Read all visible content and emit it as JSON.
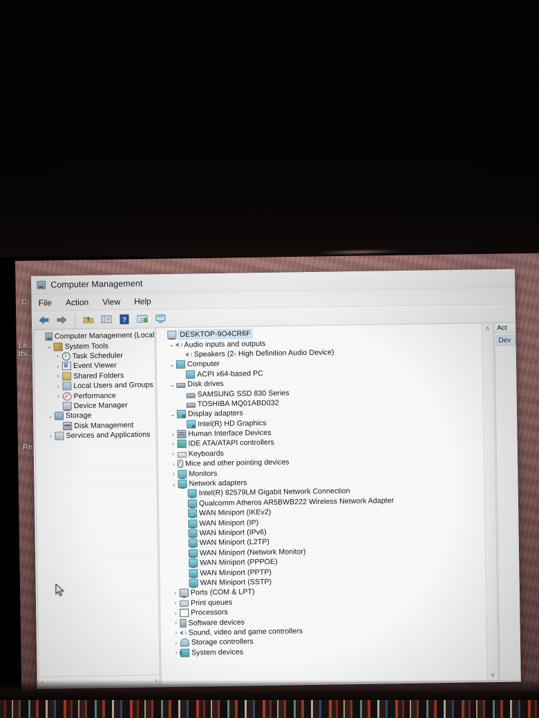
{
  "window": {
    "title": "Computer Management",
    "icon": "computer-management-icon",
    "menu": [
      "File",
      "Action",
      "View",
      "Help"
    ],
    "toolbar": [
      {
        "name": "back-button",
        "glyph": "back-arrow-icon"
      },
      {
        "name": "forward-button",
        "glyph": "forward-arrow-icon"
      },
      {
        "name": "up-one-level-button",
        "glyph": "up-folder-icon"
      },
      {
        "name": "show-hide-console-tree-button",
        "glyph": "console-tree-icon"
      },
      {
        "name": "help-button",
        "glyph": "help-icon"
      },
      {
        "name": "properties-button",
        "glyph": "properties-icon"
      },
      {
        "name": "show-hide-action-pane-button",
        "glyph": "monitor-icon"
      }
    ]
  },
  "console_tree": {
    "root": {
      "label": "Computer Management (Local",
      "icon": "mmc-icon"
    },
    "items": [
      {
        "label": "System Tools",
        "icon": "system-tools-icon",
        "twisty": "expanded",
        "level": 1
      },
      {
        "label": "Task Scheduler",
        "icon": "clock-icon",
        "twisty": "collapsed",
        "level": 2
      },
      {
        "label": "Event Viewer",
        "icon": "event-viewer-icon",
        "twisty": "collapsed",
        "level": 2
      },
      {
        "label": "Shared Folders",
        "icon": "shared-folders-icon",
        "twisty": "collapsed",
        "level": 2
      },
      {
        "label": "Local Users and Groups",
        "icon": "users-icon",
        "twisty": "collapsed",
        "level": 2
      },
      {
        "label": "Performance",
        "icon": "performance-icon",
        "twisty": "collapsed",
        "level": 2
      },
      {
        "label": "Device Manager",
        "icon": "device-manager-icon",
        "twisty": "none",
        "level": 2
      },
      {
        "label": "Storage",
        "icon": "storage-icon",
        "twisty": "expanded",
        "level": 1
      },
      {
        "label": "Disk Management",
        "icon": "disk-management-icon",
        "twisty": "none",
        "level": 2
      },
      {
        "label": "Services and Applications",
        "icon": "services-icon",
        "twisty": "collapsed",
        "level": 1
      }
    ],
    "hscroll": {
      "left": "‹",
      "right": "›"
    }
  },
  "device_tree": {
    "computer_name": "DESKTOP-9O4CR6F",
    "computer_icon": "device-manager-icon",
    "nodes": [
      {
        "label": "Audio inputs and outputs",
        "icon": "audio-icon",
        "twisty": "expanded",
        "level": 1
      },
      {
        "label": "Speakers (2- High Definition Audio Device)",
        "icon": "audio-icon",
        "twisty": "none",
        "level": 2
      },
      {
        "label": "Computer",
        "icon": "computer-icon",
        "twisty": "expanded",
        "level": 1
      },
      {
        "label": "ACPI x64-based PC",
        "icon": "computer-icon",
        "twisty": "none",
        "level": 2
      },
      {
        "label": "Disk drives",
        "icon": "disk-drive-icon",
        "twisty": "expanded",
        "level": 1
      },
      {
        "label": "SAMSUNG SSD 830 Series",
        "icon": "disk-drive-icon",
        "twisty": "none",
        "level": 2
      },
      {
        "label": "TOSHIBA MQ01ABD032",
        "icon": "disk-drive-icon",
        "twisty": "none",
        "level": 2
      },
      {
        "label": "Display adapters",
        "icon": "display-adapter-icon",
        "twisty": "expanded",
        "level": 1
      },
      {
        "label": "Intel(R) HD Graphics",
        "icon": "display-adapter-icon",
        "twisty": "none",
        "level": 2
      },
      {
        "label": "Human Interface Devices",
        "icon": "hid-icon",
        "twisty": "collapsed",
        "level": 1
      },
      {
        "label": "IDE ATA/ATAPI controllers",
        "icon": "ide-icon",
        "twisty": "collapsed",
        "level": 1
      },
      {
        "label": "Keyboards",
        "icon": "keyboard-icon",
        "twisty": "collapsed",
        "level": 1
      },
      {
        "label": "Mice and other pointing devices",
        "icon": "mouse-icon",
        "twisty": "collapsed",
        "level": 1
      },
      {
        "label": "Monitors",
        "icon": "monitor-icon",
        "twisty": "collapsed",
        "level": 1
      },
      {
        "label": "Network adapters",
        "icon": "network-adapter-icon",
        "twisty": "expanded",
        "level": 1
      },
      {
        "label": "Intel(R) 82579LM Gigabit Network Connection",
        "icon": "network-adapter-icon",
        "twisty": "none",
        "level": 2
      },
      {
        "label": "Qualcomm Atheros AR5BWB222 Wireless Network Adapter",
        "icon": "network-adapter-icon",
        "twisty": "none",
        "level": 2
      },
      {
        "label": "WAN Miniport (IKEv2)",
        "icon": "network-adapter-icon",
        "twisty": "none",
        "level": 2
      },
      {
        "label": "WAN Miniport (IP)",
        "icon": "network-adapter-icon",
        "twisty": "none",
        "level": 2
      },
      {
        "label": "WAN Miniport (IPv6)",
        "icon": "network-adapter-icon",
        "twisty": "none",
        "level": 2
      },
      {
        "label": "WAN Miniport (L2TP)",
        "icon": "network-adapter-icon",
        "twisty": "none",
        "level": 2
      },
      {
        "label": "WAN Miniport (Network Monitor)",
        "icon": "network-adapter-icon",
        "twisty": "none",
        "level": 2
      },
      {
        "label": "WAN Miniport (PPPOE)",
        "icon": "network-adapter-icon",
        "twisty": "none",
        "level": 2
      },
      {
        "label": "WAN Miniport (PPTP)",
        "icon": "network-adapter-icon",
        "twisty": "none",
        "level": 2
      },
      {
        "label": "WAN Miniport (SSTP)",
        "icon": "network-adapter-icon",
        "twisty": "none",
        "level": 2
      },
      {
        "label": "Ports (COM & LPT)",
        "icon": "port-icon",
        "twisty": "collapsed",
        "level": 1
      },
      {
        "label": "Print queues",
        "icon": "printer-icon",
        "twisty": "collapsed",
        "level": 1
      },
      {
        "label": "Processors",
        "icon": "processor-icon",
        "twisty": "collapsed",
        "level": 1
      },
      {
        "label": "Software devices",
        "icon": "software-device-icon",
        "twisty": "collapsed",
        "level": 1
      },
      {
        "label": "Sound, video and game controllers",
        "icon": "sound-icon",
        "twisty": "collapsed",
        "level": 1
      },
      {
        "label": "Storage controllers",
        "icon": "storage-controller-icon",
        "twisty": "collapsed",
        "level": 1
      },
      {
        "label": "System devices",
        "icon": "system-device-icon",
        "twisty": "collapsed",
        "level": 1
      }
    ],
    "vscroll": {
      "up": "∧",
      "down": "∨"
    }
  },
  "actions_pane": {
    "header": "Act",
    "item": "Dev"
  },
  "desktop": {
    "icon_labels": [
      "C",
      "Le…\nthi…",
      "Re"
    ]
  },
  "colors": {
    "window_chrome": "#f0f0f0",
    "selection": "#dce9f7",
    "wallpaper": "#b7817f",
    "bezel": "#050404"
  }
}
